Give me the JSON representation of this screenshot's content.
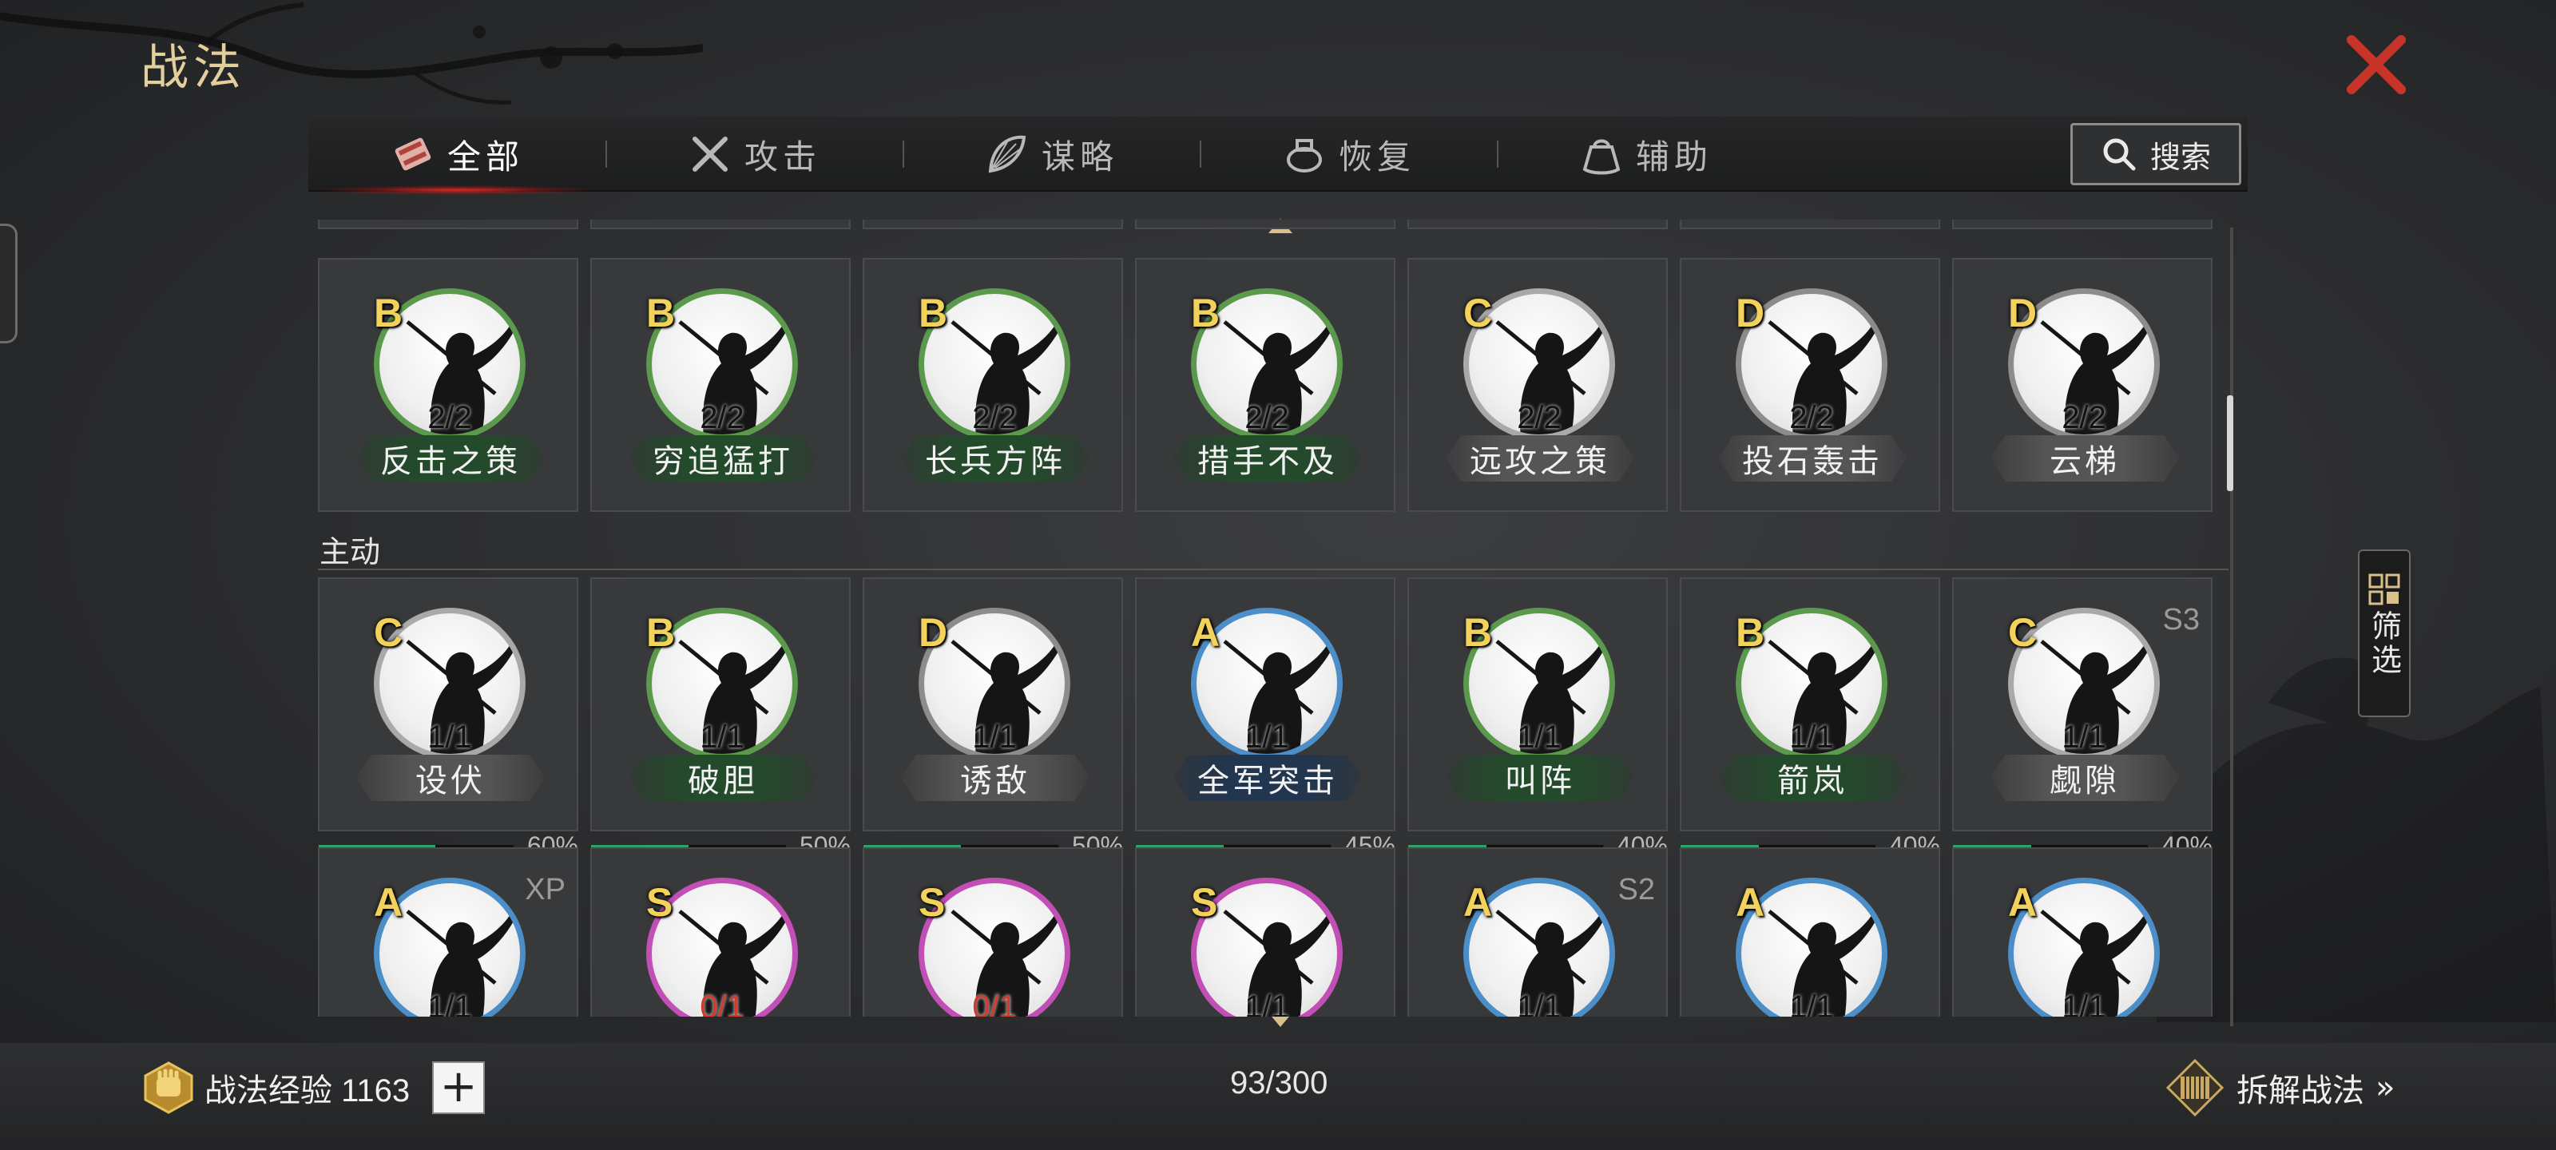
{
  "page": {
    "title": "战法"
  },
  "tabs": [
    {
      "label": "全部",
      "icon": "scroll-bundle-icon",
      "active": true
    },
    {
      "label": "攻击",
      "icon": "crossed-swords-icon",
      "active": false
    },
    {
      "label": "谋略",
      "icon": "feather-fan-icon",
      "active": false
    },
    {
      "label": "恢复",
      "icon": "medicine-pot-icon",
      "active": false
    },
    {
      "label": "辅助",
      "icon": "pouch-icon",
      "active": false
    }
  ],
  "search": {
    "label": "搜索"
  },
  "filter": {
    "label": "筛选"
  },
  "section": {
    "active_label": "主动"
  },
  "colors": {
    "accent_gold": "#e3cf9c",
    "close_red": "#c9342a",
    "progress_green": "#2fa268",
    "grade_yellow": "#f2d25a"
  },
  "rows": [
    {
      "cards": [
        {
          "grade": "B",
          "count": "2/2",
          "name": "反击之策",
          "plate": "green"
        },
        {
          "grade": "B",
          "count": "2/2",
          "name": "穷追猛打",
          "plate": "green"
        },
        {
          "grade": "B",
          "count": "2/2",
          "name": "长兵方阵",
          "plate": "green"
        },
        {
          "grade": "B",
          "count": "2/2",
          "name": "措手不及",
          "plate": "green"
        },
        {
          "grade": "C",
          "count": "2/2",
          "name": "远攻之策",
          "plate": "gray"
        },
        {
          "grade": "D",
          "count": "2/2",
          "name": "投石轰击",
          "plate": "gray"
        },
        {
          "grade": "D",
          "count": "2/2",
          "name": "云梯",
          "plate": "gray"
        }
      ]
    },
    {
      "cards": [
        {
          "grade": "C",
          "count": "1/1",
          "name": "设伏",
          "plate": "gray",
          "progress": 0.6,
          "pct": "60%",
          "season": ""
        },
        {
          "grade": "B",
          "count": "1/1",
          "name": "破胆",
          "plate": "green",
          "progress": 0.5,
          "pct": "50%",
          "season": ""
        },
        {
          "grade": "D",
          "count": "1/1",
          "name": "诱敌",
          "plate": "gray",
          "progress": 0.5,
          "pct": "50%",
          "season": ""
        },
        {
          "grade": "A",
          "count": "1/1",
          "name": "全军突击",
          "plate": "blue",
          "progress": 0.45,
          "pct": "45%",
          "season": ""
        },
        {
          "grade": "B",
          "count": "1/1",
          "name": "叫阵",
          "plate": "green",
          "progress": 0.4,
          "pct": "40%",
          "season": ""
        },
        {
          "grade": "B",
          "count": "1/1",
          "name": "箭岚",
          "plate": "green",
          "progress": 0.4,
          "pct": "40%",
          "season": ""
        },
        {
          "grade": "C",
          "count": "1/1",
          "name": "觑隙",
          "plate": "gray",
          "progress": 0.4,
          "pct": "40%",
          "season": "S3"
        }
      ]
    },
    {
      "cards": [
        {
          "grade": "A",
          "count": "1/1",
          "season": "XP"
        },
        {
          "grade": "S",
          "count": "0/1",
          "season": ""
        },
        {
          "grade": "S",
          "count": "0/1",
          "season": ""
        },
        {
          "grade": "S",
          "count": "1/1",
          "season": ""
        },
        {
          "grade": "A",
          "count": "1/1",
          "season": "S2"
        },
        {
          "grade": "A",
          "count": "1/1",
          "season": ""
        },
        {
          "grade": "A",
          "count": "1/1",
          "season": ""
        }
      ]
    }
  ],
  "footer": {
    "exp_label": "战法经验 1163",
    "plus": "+",
    "capacity": "93/300",
    "dismantle_label": "拆解战法",
    "dismantle_chevron": "»"
  }
}
